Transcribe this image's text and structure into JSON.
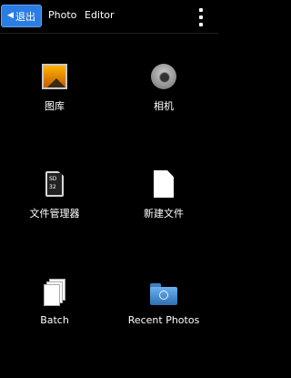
{
  "toolbar": {
    "back_label": "退出",
    "tabs": [
      "Photo",
      "Editor"
    ]
  },
  "grid": {
    "items": [
      {
        "label": "图库",
        "icon": "gallery-icon"
      },
      {
        "label": "相机",
        "icon": "camera-icon"
      },
      {
        "label": "文件管理器",
        "icon": "sd-card-icon"
      },
      {
        "label": "新建文件",
        "icon": "new-file-icon"
      },
      {
        "label": "Batch",
        "icon": "batch-icon"
      },
      {
        "label": "Recent Photos",
        "icon": "recent-folder-icon"
      }
    ],
    "sd_card_text": [
      "SD",
      "32"
    ]
  },
  "colors": {
    "accent": "#2b7de3",
    "background": "#000000",
    "text": "#ffffff"
  }
}
